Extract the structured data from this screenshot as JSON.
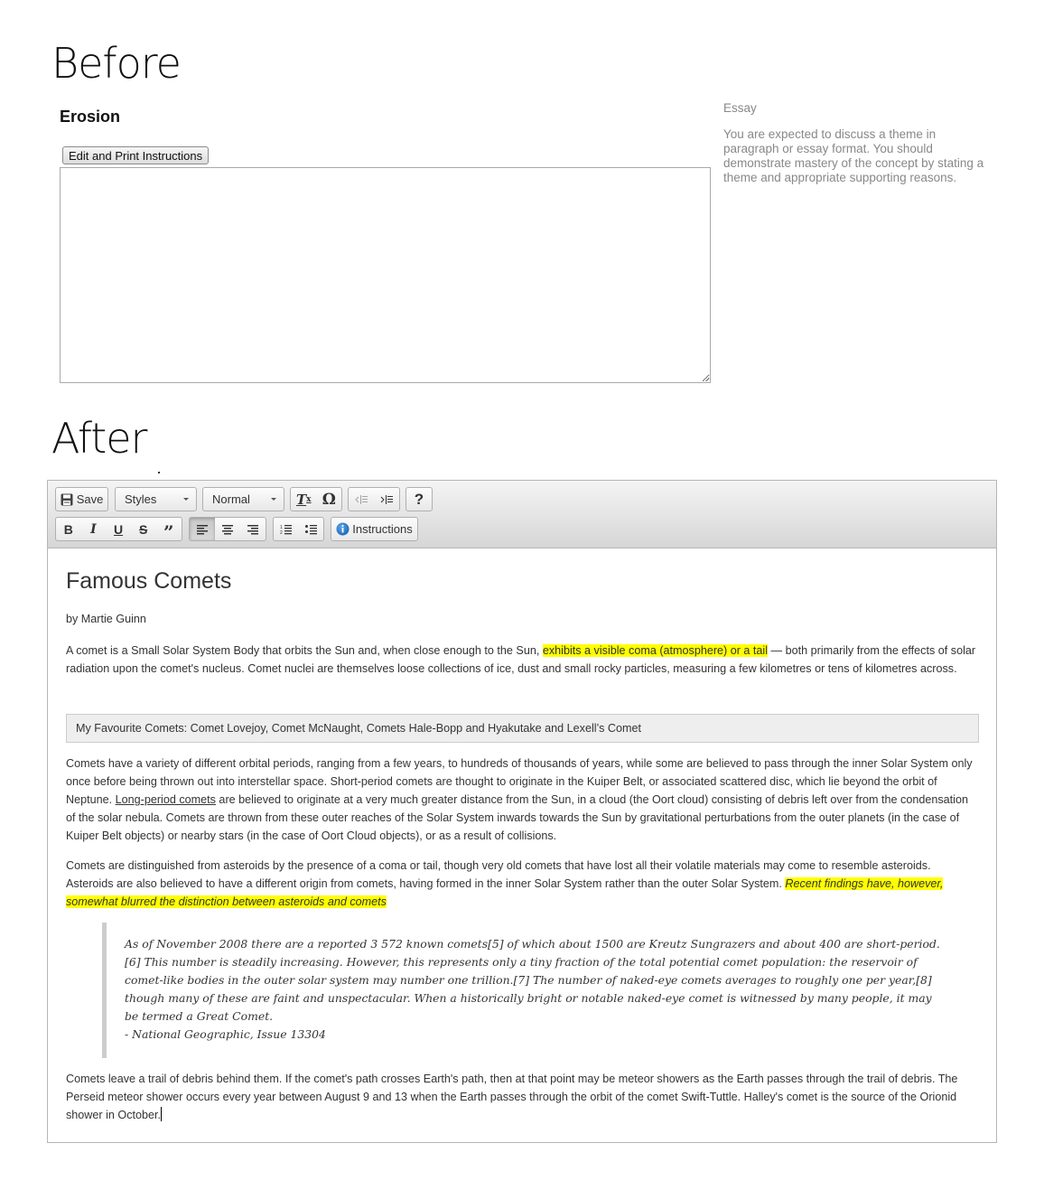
{
  "before": {
    "heading": "Before",
    "assignment_title": "Erosion",
    "edit_print_button": "Edit and Print Instructions",
    "answer_value": "",
    "side_type": "Essay",
    "side_description": "You are expected to discuss a theme in paragraph or essay format. You should demonstrate mastery of the concept by stating a theme and appropriate supporting reasons."
  },
  "after": {
    "heading": "After",
    "toolbar": {
      "save_label": "Save",
      "styles_combo": "Styles",
      "format_combo": "Normal",
      "instructions_label": "Instructions",
      "help_label": "?",
      "buttons": [
        {
          "name": "save",
          "icon": "floppy-disk-icon"
        },
        {
          "name": "remove-format",
          "icon": "remove-format-icon"
        },
        {
          "name": "special-char",
          "icon": "omega-icon"
        },
        {
          "name": "outdent",
          "icon": "outdent-icon",
          "disabled": true
        },
        {
          "name": "indent",
          "icon": "indent-icon"
        },
        {
          "name": "help",
          "icon": "help-icon"
        },
        {
          "name": "bold",
          "icon": "bold-icon"
        },
        {
          "name": "italic",
          "icon": "italic-icon"
        },
        {
          "name": "underline",
          "icon": "underline-icon"
        },
        {
          "name": "strikethrough",
          "icon": "strikethrough-icon"
        },
        {
          "name": "blockquote",
          "icon": "quote-icon"
        },
        {
          "name": "align-left",
          "icon": "align-left-icon",
          "active": true
        },
        {
          "name": "align-center",
          "icon": "align-center-icon"
        },
        {
          "name": "align-right",
          "icon": "align-right-icon"
        },
        {
          "name": "numbered-list",
          "icon": "numbered-list-icon"
        },
        {
          "name": "bulleted-list",
          "icon": "bulleted-list-icon"
        },
        {
          "name": "instructions",
          "icon": "info-icon"
        }
      ],
      "info_icon_color": "#1e73be"
    },
    "document": {
      "title": "Famous Comets",
      "byline": "by Martie Guinn",
      "p1_before": "A comet is a Small Solar System Body that orbits the Sun and, when close enough to the Sun, ",
      "p1_highlight": "exhibits a visible coma (atmosphere) or a tail",
      "p1_after": " — both primarily from the effects of solar radiation upon the comet's nucleus. Comet nuclei are themselves loose collections of ice, dust and small rocky particles, measuring a few kilometres or tens of kilometres across.",
      "favourites": "My Favourite Comets: Comet Lovejoy, Comet McNaught, Comets Hale-Bopp and Hyakutake and Lexell’s Comet",
      "p2_before": "Comets have a variety of different orbital periods, ranging from a few years, to hundreds of thousands of years, while some are believed to pass through the inner Solar System only once before being thrown out into interstellar space. Short-period comets are thought to originate in the Kuiper Belt, or associated scattered disc, which lie beyond the orbit of Neptune. ",
      "p2_underline": "Long-period comets",
      "p2_after": " are believed to originate at a very much greater distance from the Sun, in a cloud (the Oort cloud) consisting of debris left over from the condensation of the solar nebula. Comets are thrown from these outer reaches of the Solar System inwards towards the Sun by gravitational perturbations from the outer planets (in the case of Kuiper Belt objects) or nearby stars (in the case of Oort Cloud objects), or as a result of collisions.",
      "p3_before": "Comets are distinguished from asteroids by the presence of a coma or tail, though very old comets that have lost all their volatile materials may come to resemble asteroids. Asteroids are also believed to have a different origin from comets, having formed in the inner Solar System rather than the outer Solar System. ",
      "p3_highlight": "Recent findings have, however, somewhat blurred the distinction between asteroids and comets",
      "quote_text": "As of November 2008 there are a reported 3 572 known comets[5] of which about 1500 are Kreutz Sungrazers and about 400 are short-period.[6] This number is steadily increasing. However, this represents only a tiny fraction of the total potential comet population: the reservoir of comet-like bodies in the outer solar system may number one trillion.[7] The number of naked-eye comets averages to roughly one per year,[8] though many of these are faint and unspectacular. When a historically bright or notable naked-eye comet is witnessed by many people, it may be termed a Great Comet.",
      "quote_source": "- National Geographic, Issue 13304",
      "p4": "Comets leave a trail of debris behind them. If the comet's path crosses Earth's path, then at that point may be meteor showers as the Earth passes through the trail of debris. The Perseid meteor shower occurs every year between August 9 and 13 when the Earth passes through the orbit of the comet Swift-Tuttle. Halley's comet is the source of the Orionid shower in October.",
      "highlight_color": "#ffff00"
    }
  }
}
